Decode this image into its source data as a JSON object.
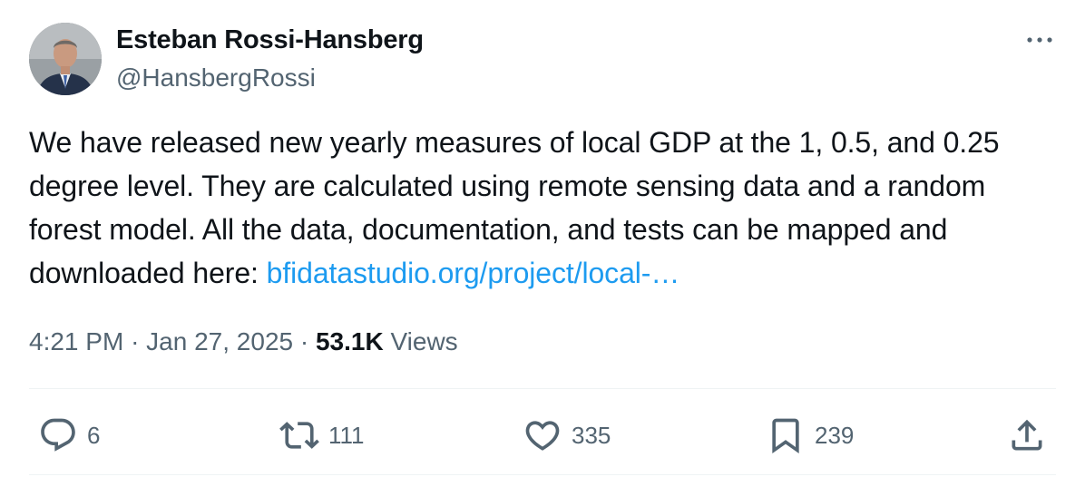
{
  "author": {
    "display_name": "Esteban Rossi-Hansberg",
    "handle": "@HansbergRossi"
  },
  "tweet": {
    "text": "We have released new yearly measures of local GDP at the 1, 0.5, and 0.25 degree level. They are calculated using remote sensing data and a random forest model. All the data, documentation, and tests can be mapped and downloaded here: ",
    "link_text": "bfidatastudio.org/project/local-…"
  },
  "meta": {
    "time": "4:21 PM",
    "separator": "·",
    "date": "Jan 27, 2025",
    "views_count": "53.1K",
    "views_label": "Views"
  },
  "actions": {
    "replies": "6",
    "reposts": "111",
    "likes": "335",
    "bookmarks": "239"
  },
  "colors": {
    "text": "#0f1419",
    "secondary": "#536471",
    "link": "#1d9bf0",
    "divider": "#eff3f4"
  },
  "icons": [
    "more-icon",
    "reply-icon",
    "repost-icon",
    "like-icon",
    "bookmark-icon",
    "share-icon"
  ]
}
